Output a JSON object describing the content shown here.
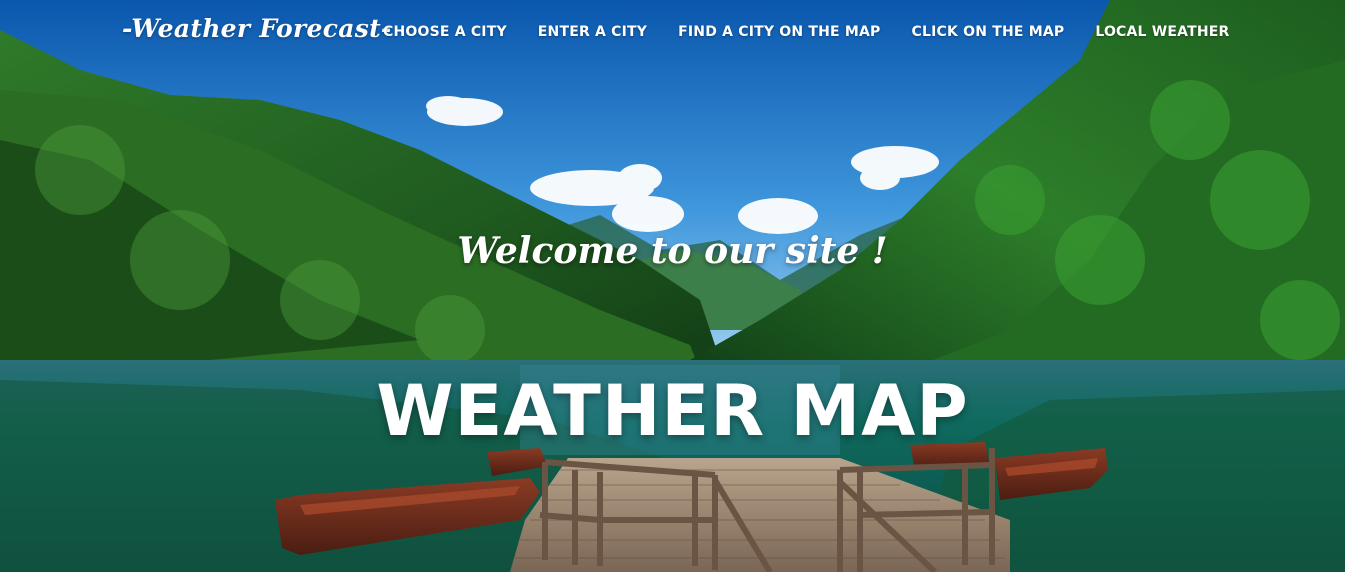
{
  "brand": {
    "title": "-Weather Forecast-"
  },
  "nav": {
    "items": [
      {
        "label": "CHOOSE A CITY"
      },
      {
        "label": "ENTER A CITY"
      },
      {
        "label": "FIND A CITY ON THE MAP"
      },
      {
        "label": "CLICK ON THE MAP"
      },
      {
        "label": "LOCAL WEATHER"
      }
    ]
  },
  "hero": {
    "welcome": "Welcome to our site !",
    "title": "WEATHER MAP"
  },
  "colors": {
    "sky_top": "#0b5fb3",
    "sky_bottom": "#8ec8f0",
    "forest_dark": "#0f3d1c",
    "forest_light": "#3f8f2a",
    "lake": "#0e6a66",
    "dock_wood": "#8a7a68",
    "boat": "#6b2a1c"
  }
}
